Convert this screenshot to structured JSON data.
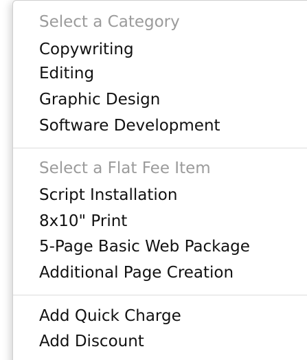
{
  "menu": {
    "groups": [
      {
        "header": "Select a Category",
        "items": [
          "Copywriting",
          "Editing",
          "Graphic Design",
          "Software Development"
        ]
      },
      {
        "header": "Select a Flat Fee Item",
        "items": [
          "Script Installation",
          "8x10\" Print",
          "5-Page Basic Web Package",
          "Additional Page Creation"
        ]
      },
      {
        "items": [
          "Add Quick Charge",
          "Add Discount"
        ]
      }
    ]
  }
}
